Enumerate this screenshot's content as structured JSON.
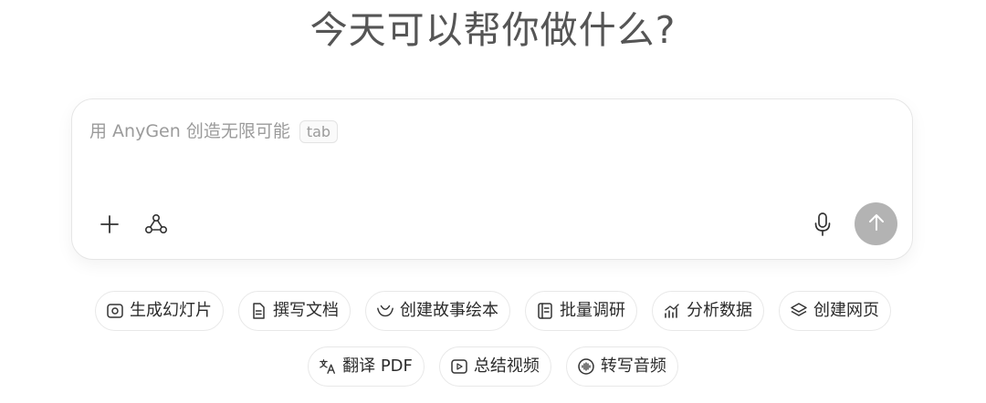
{
  "headline": "今天可以帮你做什么?",
  "composer": {
    "placeholder": "用 AnyGen 创造无限可能",
    "tab_hint": "tab",
    "tools": {
      "add_icon": "plus-icon",
      "workflow_icon": "nodes-icon",
      "mic_icon": "microphone-icon",
      "send_icon": "arrow-up-icon"
    },
    "send_color": "#b3b3b3"
  },
  "chips": {
    "row1": [
      {
        "label": "生成幻灯片",
        "icon": "slides-icon"
      },
      {
        "label": "撰写文档",
        "icon": "document-icon"
      },
      {
        "label": "创建故事绘本",
        "icon": "storybook-icon"
      },
      {
        "label": "批量调研",
        "icon": "research-icon"
      },
      {
        "label": "分析数据",
        "icon": "chart-icon"
      },
      {
        "label": "创建网页",
        "icon": "layers-icon"
      }
    ],
    "row2": [
      {
        "label": "翻译 PDF",
        "icon": "translate-icon"
      },
      {
        "label": "总结视频",
        "icon": "video-icon"
      },
      {
        "label": "转写音频",
        "icon": "audio-icon"
      }
    ]
  }
}
